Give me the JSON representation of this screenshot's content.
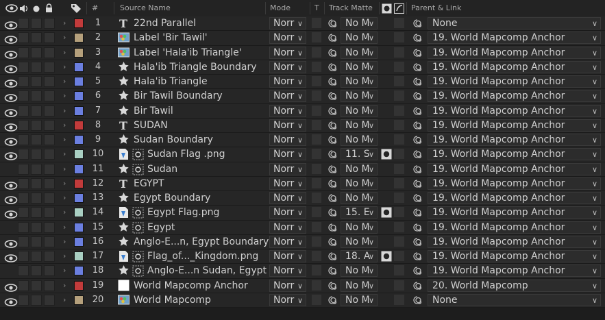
{
  "header": {
    "label_col_icon": "label-tag-icon",
    "hash": "#",
    "source_name": "Source Name",
    "mode": "Mode",
    "t": "T",
    "track_matte": "Track Matte",
    "parent_link": "Parent & Link"
  },
  "colors": {
    "red": "#c23b3b",
    "tan": "#b5a07c",
    "blue": "#6b7fe0",
    "seafoam": "#a9cfc2",
    "white": "#ffffff"
  },
  "layers": [
    {
      "num": "1",
      "name": "22nd Parallel",
      "type": "text",
      "label": "red",
      "mode": "Norr",
      "track": "No M",
      "parent": "None",
      "eye": true,
      "matte_icon": false
    },
    {
      "num": "2",
      "name": "Label 'Bir Tawil'",
      "type": "comp",
      "label": "tan",
      "mode": "Norr",
      "track": "No M",
      "parent": "19. World Mapcomp Anchor",
      "eye": true,
      "matte_icon": false
    },
    {
      "num": "3",
      "name": "Label 'Hala'ib Triangle'",
      "type": "comp",
      "label": "tan",
      "mode": "Norr",
      "track": "No M",
      "parent": "19. World Mapcomp Anchor",
      "eye": true,
      "matte_icon": false
    },
    {
      "num": "4",
      "name": "Hala'ib Triangle Boundary",
      "type": "shape",
      "label": "blue",
      "mode": "Norr",
      "track": "No M",
      "parent": "19. World Mapcomp Anchor",
      "eye": true,
      "matte_icon": false
    },
    {
      "num": "5",
      "name": "Hala'ib Triangle",
      "type": "shape",
      "label": "blue",
      "mode": "Norr",
      "track": "No M",
      "parent": "19. World Mapcomp Anchor",
      "eye": true,
      "matte_icon": false
    },
    {
      "num": "6",
      "name": "Bir Tawil Boundary",
      "type": "shape",
      "label": "blue",
      "mode": "Norr",
      "track": "No M",
      "parent": "19. World Mapcomp Anchor",
      "eye": true,
      "matte_icon": false
    },
    {
      "num": "7",
      "name": "Bir Tawil",
      "type": "shape",
      "label": "blue",
      "mode": "Norr",
      "track": "No M",
      "parent": "19. World Mapcomp Anchor",
      "eye": true,
      "matte_icon": false
    },
    {
      "num": "8",
      "name": "SUDAN",
      "type": "text",
      "label": "red",
      "mode": "Norr",
      "track": "No M",
      "parent": "19. World Mapcomp Anchor",
      "eye": true,
      "matte_icon": false
    },
    {
      "num": "9",
      "name": "Sudan Boundary",
      "type": "shape",
      "label": "blue",
      "mode": "Norr",
      "track": "No M",
      "parent": "19. World Mapcomp Anchor",
      "eye": true,
      "matte_icon": false
    },
    {
      "num": "10",
      "name": "Sudan Flag .png",
      "type": "footage",
      "label": "seafoam",
      "mode": "Norr",
      "track": "11. S",
      "parent": "19. World Mapcomp Anchor",
      "eye": true,
      "matte_icon": true
    },
    {
      "num": "11",
      "name": "Sudan",
      "type": "shape-matte",
      "label": "blue",
      "mode": "Norr",
      "track": "No M",
      "parent": "19. World Mapcomp Anchor",
      "eye": false,
      "matte_icon": false
    },
    {
      "num": "12",
      "name": "EGYPT",
      "type": "text",
      "label": "red",
      "mode": "Norr",
      "track": "No M",
      "parent": "19. World Mapcomp Anchor",
      "eye": true,
      "matte_icon": false
    },
    {
      "num": "13",
      "name": "Egypt Boundary",
      "type": "shape",
      "label": "blue",
      "mode": "Norr",
      "track": "No M",
      "parent": "19. World Mapcomp Anchor",
      "eye": true,
      "matte_icon": false
    },
    {
      "num": "14",
      "name": "Egypt Flag.png",
      "type": "footage",
      "label": "seafoam",
      "mode": "Norr",
      "track": "15. E",
      "parent": "19. World Mapcomp Anchor",
      "eye": true,
      "matte_icon": true
    },
    {
      "num": "15",
      "name": "Egypt",
      "type": "shape-matte",
      "label": "blue",
      "mode": "Norr",
      "track": "No M",
      "parent": "19. World Mapcomp Anchor",
      "eye": false,
      "matte_icon": false
    },
    {
      "num": "16",
      "name": "Anglo-E...n, Egypt Boundary",
      "type": "shape",
      "label": "blue",
      "mode": "Norr",
      "track": "No M",
      "parent": "19. World Mapcomp Anchor",
      "eye": true,
      "matte_icon": false
    },
    {
      "num": "17",
      "name": "Flag_of..._Kingdom.png",
      "type": "footage",
      "label": "seafoam",
      "mode": "Norr",
      "track": "18. A",
      "parent": "19. World Mapcomp Anchor",
      "eye": true,
      "matte_icon": true
    },
    {
      "num": "18",
      "name": "Anglo-E...n Sudan, Egypt",
      "type": "shape-matte",
      "label": "blue",
      "mode": "Norr",
      "track": "No M",
      "parent": "19. World Mapcomp Anchor",
      "eye": false,
      "matte_icon": false
    },
    {
      "num": "19",
      "name": "World Mapcomp Anchor",
      "type": "solid",
      "label": "red",
      "mode": "Norr",
      "track": "No M",
      "parent": "20. World Mapcomp",
      "eye": true,
      "matte_icon": false
    },
    {
      "num": "20",
      "name": "World Mapcomp",
      "type": "comp",
      "label": "tan",
      "mode": "Norr",
      "track": "No M",
      "parent": "None",
      "eye": true,
      "matte_icon": false
    }
  ]
}
